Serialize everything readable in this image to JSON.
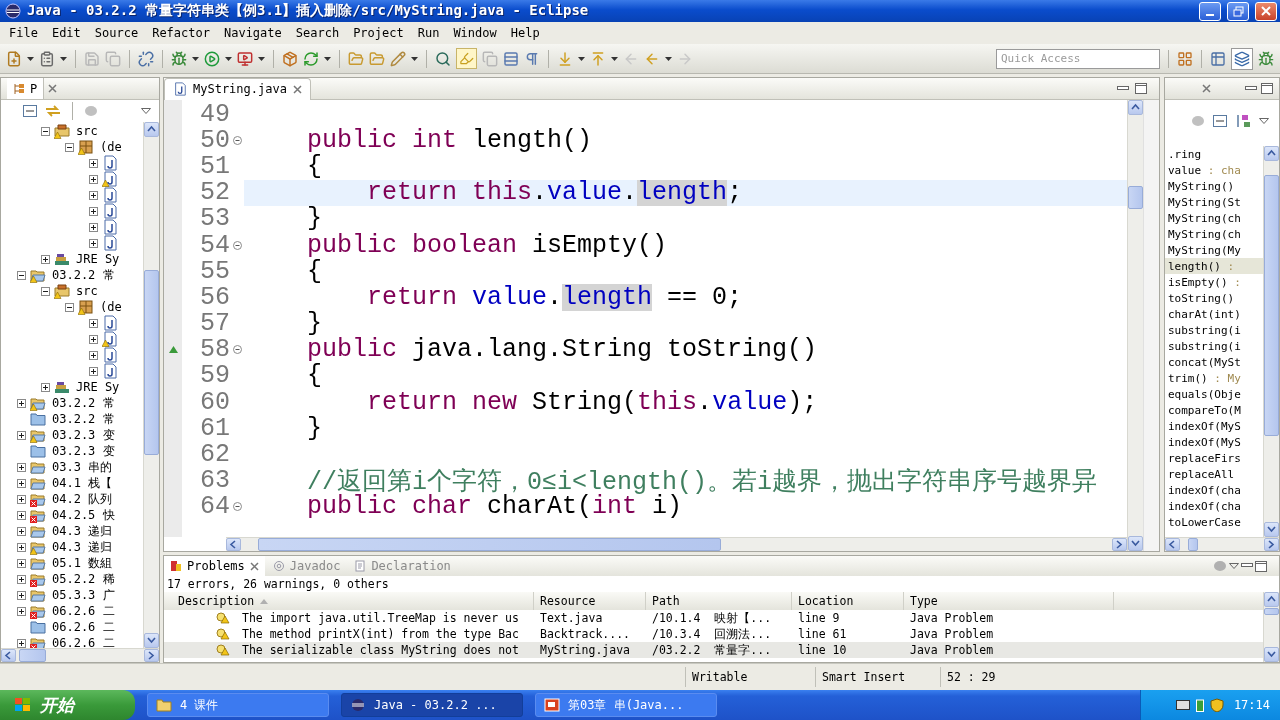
{
  "window": {
    "title": "Java - 03.2.2  常量字符串类【例3.1】插入删除/src/MyString.java - Eclipse"
  },
  "menu": [
    "File",
    "Edit",
    "Source",
    "Refactor",
    "Navigate",
    "Search",
    "Project",
    "Run",
    "Window",
    "Help"
  ],
  "toolbar": {
    "quick_access": {
      "placeholder": "Quick Access"
    }
  },
  "package_explorer": {
    "tab": {
      "label": "P",
      "selected": true
    },
    "continued_items": [
      {
        "kind": "source-folder",
        "label": "src",
        "expanded": true,
        "warning": true,
        "error": false,
        "children": [
          {
            "kind": "package",
            "label": "(de",
            "expanded": true,
            "warning": true,
            "error": false,
            "children": [
              {
                "kind": "java-file",
                "expanded": false,
                "warning": false,
                "error": false
              },
              {
                "kind": "java-file",
                "expanded": false,
                "warning": true,
                "error": false
              },
              {
                "kind": "java-file",
                "expanded": false,
                "warning": false,
                "error": false
              },
              {
                "kind": "java-file",
                "expanded": false,
                "warning": false,
                "error": false
              },
              {
                "kind": "java-file",
                "expanded": false,
                "warning": false,
                "error": false
              },
              {
                "kind": "java-file",
                "expanded": false,
                "warning": false,
                "error": false
              }
            ]
          }
        ]
      },
      {
        "kind": "library",
        "label": "JRE Sy",
        "expanded": false,
        "warning": false,
        "error": false
      }
    ],
    "items": [
      {
        "kind": "project",
        "label": "03.2.2  常",
        "expanded": true,
        "warning": true,
        "error": false,
        "children": [
          {
            "kind": "source-folder",
            "label": "src",
            "expanded": true,
            "warning": true,
            "error": false,
            "children": [
              {
                "kind": "package",
                "label": "(de",
                "expanded": true,
                "warning": true,
                "error": false,
                "children": [
                  {
                    "kind": "java-file",
                    "expanded": false,
                    "warning": false,
                    "error": false
                  },
                  {
                    "kind": "java-file",
                    "expanded": false,
                    "warning": true,
                    "error": false
                  },
                  {
                    "kind": "java-file",
                    "expanded": false,
                    "warning": false,
                    "error": false
                  },
                  {
                    "kind": "java-file",
                    "expanded": false,
                    "warning": false,
                    "error": false
                  }
                ]
              }
            ]
          },
          {
            "kind": "library",
            "label": "JRE Sy",
            "expanded": false,
            "warning": false,
            "error": false
          }
        ]
      },
      {
        "kind": "project",
        "label": "03.2.2  常",
        "expanded": false,
        "warning": true,
        "error": false
      },
      {
        "kind": "folder",
        "label": "03.2.2  常",
        "warning": false,
        "error": false
      },
      {
        "kind": "project",
        "label": "03.2.3  变",
        "expanded": false,
        "warning": true,
        "error": false
      },
      {
        "kind": "folder",
        "label": "03.2.3  变",
        "warning": false,
        "error": false
      },
      {
        "kind": "project",
        "label": "03.3  串的",
        "expanded": false,
        "warning": false,
        "error": false
      },
      {
        "kind": "project",
        "label": "04.1  栈【",
        "expanded": false,
        "warning": false,
        "error": false
      },
      {
        "kind": "project",
        "label": "04.2  队列",
        "expanded": false,
        "warning": false,
        "error": true
      },
      {
        "kind": "project",
        "label": "04.2.5  快",
        "expanded": false,
        "warning": false,
        "error": true
      },
      {
        "kind": "project",
        "label": "04.3  递归",
        "expanded": false,
        "warning": false,
        "error": false
      },
      {
        "kind": "project",
        "label": "04.3  递归",
        "expanded": false,
        "warning": true,
        "error": false
      },
      {
        "kind": "project",
        "label": "05.1  数組",
        "expanded": false,
        "warning": false,
        "error": false
      },
      {
        "kind": "project",
        "label": "05.2.2  稀",
        "expanded": false,
        "warning": false,
        "error": true
      },
      {
        "kind": "project",
        "label": "05.3.3  广",
        "expanded": false,
        "warning": false,
        "error": false
      },
      {
        "kind": "project",
        "label": "06.2.6  二",
        "expanded": false,
        "warning": false,
        "error": true
      },
      {
        "kind": "folder",
        "label": "06.2.6  二",
        "warning": false,
        "error": false
      },
      {
        "kind": "project",
        "label": "06.2.6  二",
        "expanded": false,
        "warning": false,
        "error": true
      }
    ]
  },
  "editor": {
    "tab": {
      "label": "MyString.java",
      "selected": true
    },
    "lines": [
      {
        "number": "49"
      },
      {
        "number": "50",
        "foldable": true,
        "tokens": [
          {
            "text": "    public ",
            "kind": "keyword"
          },
          {
            "text": "int ",
            "kind": "keyword"
          },
          {
            "text": "length()"
          }
        ]
      },
      {
        "number": "51",
        "tokens": [
          {
            "text": "    {"
          }
        ]
      },
      {
        "number": "52",
        "current": true,
        "tokens": [
          {
            "text": "        return ",
            "kind": "keyword"
          },
          {
            "text": "this",
            "kind": "keyword"
          },
          {
            "text": "."
          },
          {
            "text": "value",
            "kind": "field"
          },
          {
            "text": "."
          },
          {
            "text": "length",
            "kind": "field",
            "occurrence": true
          },
          {
            "text": ";"
          }
        ]
      },
      {
        "number": "53",
        "tokens": [
          {
            "text": "    }"
          }
        ]
      },
      {
        "number": "54",
        "foldable": true,
        "tokens": [
          {
            "text": "    public ",
            "kind": "keyword"
          },
          {
            "text": "boolean ",
            "kind": "keyword"
          },
          {
            "text": "isEmpty()"
          }
        ]
      },
      {
        "number": "55",
        "tokens": [
          {
            "text": "    {"
          }
        ]
      },
      {
        "number": "56",
        "tokens": [
          {
            "text": "        return ",
            "kind": "keyword"
          },
          {
            "text": "value",
            "kind": "field"
          },
          {
            "text": "."
          },
          {
            "text": "length",
            "kind": "field",
            "occurrence": true
          },
          {
            "text": " == 0;"
          }
        ]
      },
      {
        "number": "57",
        "tokens": [
          {
            "text": "    }"
          }
        ]
      },
      {
        "number": "58",
        "foldable": true,
        "override": true,
        "tokens": [
          {
            "text": "    public ",
            "kind": "keyword"
          },
          {
            "text": "java.lang.String toString()"
          }
        ]
      },
      {
        "number": "59",
        "tokens": [
          {
            "text": "    {"
          }
        ]
      },
      {
        "number": "60",
        "tokens": [
          {
            "text": "        return ",
            "kind": "keyword"
          },
          {
            "text": "new ",
            "kind": "keyword"
          },
          {
            "text": "String("
          },
          {
            "text": "this",
            "kind": "keyword"
          },
          {
            "text": "."
          },
          {
            "text": "value",
            "kind": "field"
          },
          {
            "text": ");"
          }
        ]
      },
      {
        "number": "61",
        "tokens": [
          {
            "text": "    }"
          }
        ]
      },
      {
        "number": "62"
      },
      {
        "number": "63",
        "tokens": [
          {
            "text": "    //返回第i个字符，0≤i<length()。若i越界，抛出字符串序号越界异",
            "kind": "comment"
          }
        ]
      },
      {
        "number": "64",
        "foldable": true,
        "tokens": [
          {
            "text": "    public ",
            "kind": "keyword"
          },
          {
            "text": "char ",
            "kind": "keyword"
          },
          {
            "text": "charAt("
          },
          {
            "text": "int ",
            "kind": "keyword"
          },
          {
            "text": "i)"
          }
        ]
      }
    ]
  },
  "outline": {
    "items": [
      {
        "label": ".ring",
        "selected": false
      },
      {
        "label": "value",
        "type": " : cha",
        "selected": false
      },
      {
        "label": "MyString()",
        "selected": false
      },
      {
        "label": "MyString(St",
        "selected": false
      },
      {
        "label": "MyString(ch",
        "selected": false
      },
      {
        "label": "MyString(ch",
        "selected": false
      },
      {
        "label": "MyString(My",
        "selected": false
      },
      {
        "label": "length()",
        "type": " :",
        "selected": true
      },
      {
        "label": "isEmpty()",
        "type": " :",
        "selected": false
      },
      {
        "label": "toString()",
        "selected": false
      },
      {
        "label": "charAt(int)",
        "selected": false
      },
      {
        "label": "substring(i",
        "selected": false
      },
      {
        "label": "substring(i",
        "selected": false
      },
      {
        "label": "concat(MySt",
        "selected": false
      },
      {
        "label": "trim()",
        "type": " : My",
        "selected": false
      },
      {
        "label": "equals(Obje",
        "selected": false
      },
      {
        "label": "compareTo(M",
        "selected": false
      },
      {
        "label": "indexOf(MyS",
        "selected": false
      },
      {
        "label": "indexOf(MyS",
        "selected": false
      },
      {
        "label": "replaceFirs",
        "selected": false
      },
      {
        "label": "replaceAll",
        "selected": false
      },
      {
        "label": "indexOf(cha",
        "selected": false
      },
      {
        "label": "indexOf(cha",
        "selected": false
      },
      {
        "label": "toLowerCase",
        "selected": false
      }
    ]
  },
  "problems_view": {
    "tabs": [
      {
        "label": "Problems",
        "kind": "problems",
        "selected": true
      },
      {
        "label": "Javadoc",
        "kind": "javadoc",
        "selected": false
      },
      {
        "label": "Declaration",
        "kind": "declaration",
        "selected": false
      }
    ],
    "summary": "17 errors, 26 warnings, 0 others",
    "columns": [
      "Description",
      "Resource",
      "Path",
      "Location",
      "Type"
    ],
    "rows": [
      {
        "warning": true,
        "selected": false,
        "cells": [
          "The import java.util.TreeMap is never us",
          "Text.java",
          "/10.1.4  映射【...",
          "line 9",
          "Java Problem"
        ]
      },
      {
        "warning": true,
        "selected": false,
        "cells": [
          "The method printX(int) from the type Bac",
          "Backtrack....",
          "/10.3.4  回溯法...",
          "line 61",
          "Java Problem"
        ]
      },
      {
        "warning": true,
        "selected": true,
        "cells": [
          "The serializable class MyString does not",
          "MyString.java",
          "/03.2.2  常量字...",
          "line 10",
          "Java Problem"
        ]
      }
    ]
  },
  "status_bar": [
    "Writable",
    "Smart Insert",
    "52 : 29"
  ],
  "taskbar": {
    "start": "开始",
    "tasks": [
      {
        "label": "4 课件",
        "kind": "folder",
        "selected": false
      },
      {
        "label": "Java - 03.2.2  ...",
        "kind": "eclipse",
        "selected": true
      },
      {
        "label": "第03章  串(Java...",
        "kind": "slides",
        "selected": false
      }
    ],
    "clock": "17:14"
  }
}
